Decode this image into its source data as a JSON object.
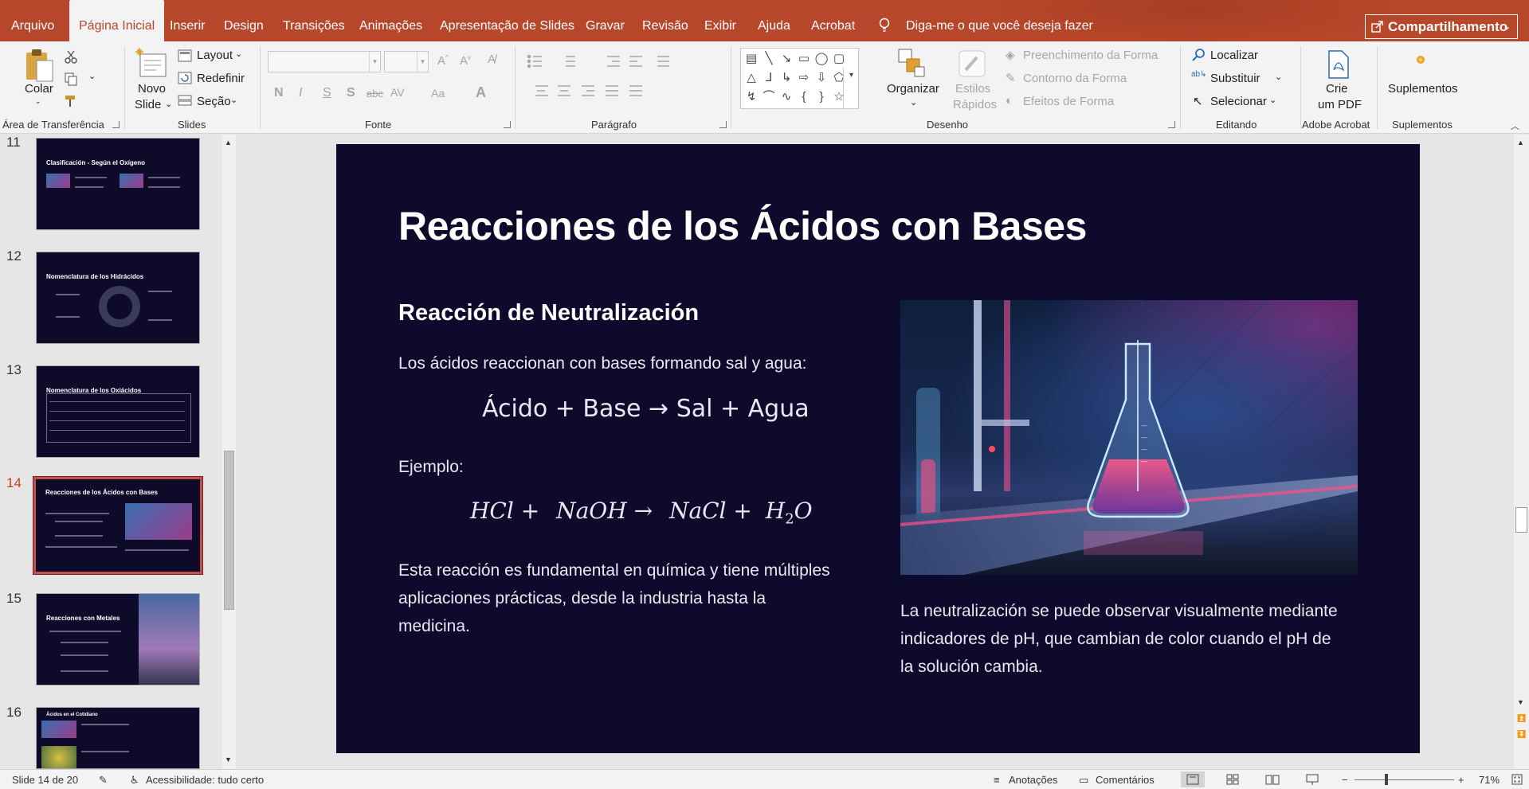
{
  "colors": {
    "accent": "#b7472a",
    "slide_bg": "#0d0a2b",
    "selected_thumb": "#c0504d"
  },
  "menu": {
    "tabs": [
      {
        "label": "Arquivo"
      },
      {
        "label": "Página Inicial"
      },
      {
        "label": "Inserir"
      },
      {
        "label": "Design"
      },
      {
        "label": "Transições"
      },
      {
        "label": "Animações"
      },
      {
        "label": "Apresentação de Slides"
      },
      {
        "label": "Gravar"
      },
      {
        "label": "Revisão"
      },
      {
        "label": "Exibir"
      },
      {
        "label": "Ajuda"
      },
      {
        "label": "Acrobat"
      }
    ],
    "active_tab": "Página Inicial",
    "tell_me": "Diga-me o que você deseja fazer",
    "share": "Compartilhamento"
  },
  "ribbon": {
    "clipboard": {
      "paste": "Colar",
      "label": "Área de Transferência"
    },
    "slides": {
      "new_slide_1": "Novo",
      "new_slide_2": "Slide",
      "layout": "Layout",
      "reset": "Redefinir",
      "section": "Seção",
      "label": "Slides"
    },
    "font": {
      "label": "Fonte",
      "bold": "N",
      "italic": "I",
      "underline": "S",
      "shadow": "S",
      "strike": "abc",
      "spacing": "AV",
      "case": "Aa",
      "color": "A"
    },
    "paragraph": {
      "label": "Parágrafo"
    },
    "drawing": {
      "arrange": "Organizar",
      "quick_styles_1": "Estilos",
      "quick_styles_2": "Rápidos",
      "fill": "Preenchimento da Forma",
      "outline": "Contorno da Forma",
      "effects": "Efeitos de Forma",
      "label": "Desenho"
    },
    "editing": {
      "find": "Localizar",
      "replace": "Substituir",
      "select": "Selecionar",
      "label": "Editando"
    },
    "acrobat": {
      "create_1": "Crie",
      "create_2": "um PDF",
      "label": "Adobe Acrobat"
    },
    "addins": {
      "addins": "Suplementos",
      "label": "Suplementos"
    }
  },
  "thumbnails": [
    {
      "number": "11",
      "title": "Clasificación - Según el Oxígeno"
    },
    {
      "number": "12",
      "title": "Nomenclatura de los Hidrácidos"
    },
    {
      "number": "13",
      "title": "Nomenclatura de los Oxiácidos"
    },
    {
      "number": "14",
      "title": "Reacciones de los Ácidos con Bases"
    },
    {
      "number": "15",
      "title": "Reacciones con Metales"
    },
    {
      "number": "16",
      "title": "Ácidos en el Cotidiano"
    }
  ],
  "selected_slide": "14",
  "slide": {
    "title": "Reacciones de los Ácidos con Bases",
    "subtitle": "Reacción de Neutralización",
    "intro": "Los ácidos reaccionan con bases formando sal y agua:",
    "equation": "Ácido + Base → Sal + Agua",
    "example_label": "Ejemplo:",
    "chem": {
      "hcl": "HCl",
      "plus1": "+",
      "naoh": "NaOH",
      "arrow": "→",
      "nacl": "NaCl",
      "plus2": "+",
      "h": "H",
      "sub2": "2",
      "o": "O"
    },
    "outro_1": "Esta reacción es fundamental en química y tiene múltiples",
    "outro_2": "aplicaciones prácticas, desde la industria hasta la",
    "outro_3": "medicina.",
    "caption_1": "La neutralización se puede observar visualmente mediante",
    "caption_2": "indicadores de pH, que cambian de color cuando el pH de",
    "caption_3": "la solución cambia."
  },
  "status": {
    "slide_count": "Slide 14 de 20",
    "accessibility": "Acessibilidade: tudo certo",
    "notes": "Anotações",
    "comments": "Comentários",
    "zoom": "71%"
  }
}
